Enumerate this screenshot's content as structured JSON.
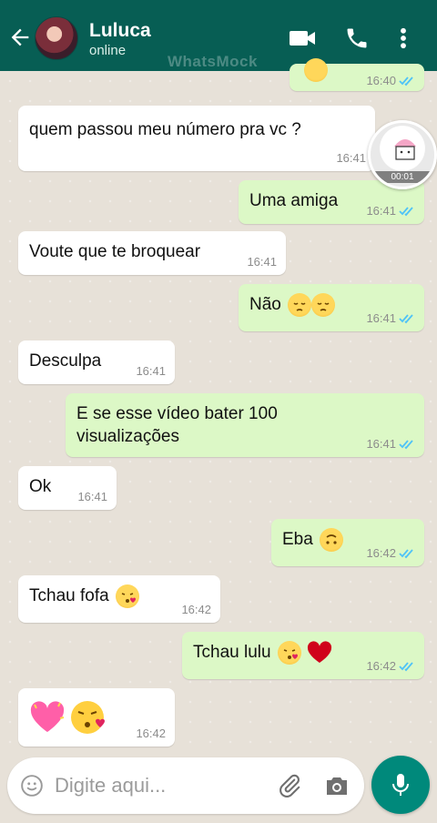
{
  "header": {
    "title": "Luluca",
    "subtitle": "online",
    "watermark": "WhatsMock"
  },
  "sticker": {
    "text": "00:01"
  },
  "messages": [
    {
      "dir": "out",
      "text": "",
      "time": "16:40"
    },
    {
      "dir": "in",
      "text": "quem passou meu número pra vc ?",
      "time": "16:41"
    },
    {
      "dir": "out",
      "text": "Uma amiga",
      "time": "16:41"
    },
    {
      "dir": "in",
      "text": "Voute que te broquear",
      "time": "16:41"
    },
    {
      "dir": "out",
      "text": "Não",
      "time": "16:41"
    },
    {
      "dir": "in",
      "text": "Desculpa",
      "time": "16:41"
    },
    {
      "dir": "out",
      "text_line1": "E se esse vídeo bater 100",
      "text_line2": "visualizações",
      "time": "16:41"
    },
    {
      "dir": "in",
      "text": "Ok",
      "time": "16:41"
    },
    {
      "dir": "out",
      "text": "Eba",
      "time": "16:42"
    },
    {
      "dir": "in",
      "text": "Tchau fofa",
      "time": "16:42"
    },
    {
      "dir": "out",
      "text": "Tchau lulu",
      "time": "16:42"
    },
    {
      "dir": "in",
      "text": "",
      "time": "16:42"
    }
  ],
  "input": {
    "placeholder": "Digite aqui..."
  },
  "colors": {
    "header": "#075e54",
    "outgoing": "#dcf8c6",
    "incoming": "#ffffff",
    "ticks": "#4fc3f7",
    "mic": "#00897b"
  }
}
